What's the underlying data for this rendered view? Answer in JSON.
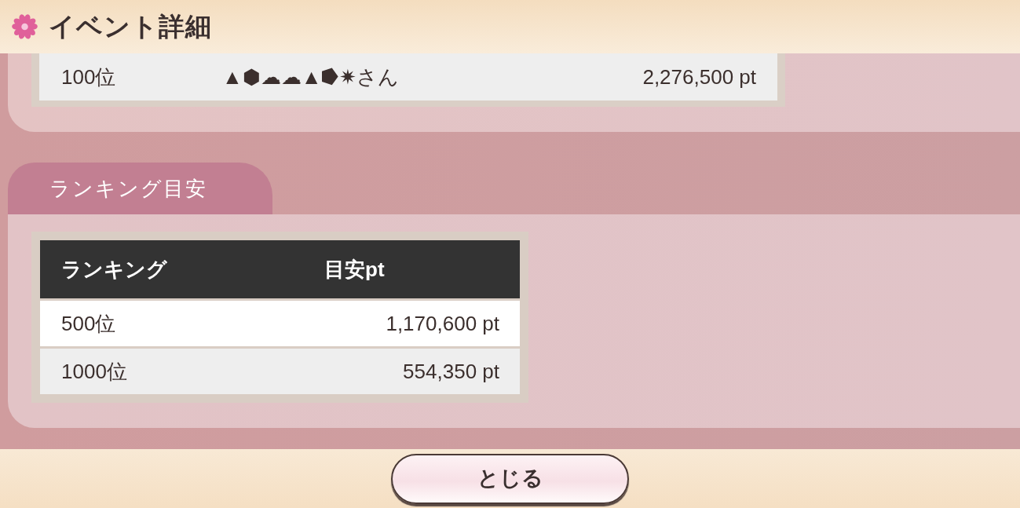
{
  "header": {
    "title": "イベント詳細"
  },
  "top_ranking": {
    "rows": [
      {
        "rank": "100位",
        "name": "▲⬢☁☁▲⭓✷さん",
        "points": "2,276,500 pt"
      }
    ]
  },
  "ranking_guide": {
    "tab": "ランキング目安",
    "columns": [
      "ランキング",
      "目安pt"
    ],
    "rows": [
      {
        "rank": "500位",
        "points": "1,170,600 pt"
      },
      {
        "rank": "1000位",
        "points": "554,350 pt"
      }
    ]
  },
  "buttons": [
    {
      "label": "とじる"
    }
  ]
}
